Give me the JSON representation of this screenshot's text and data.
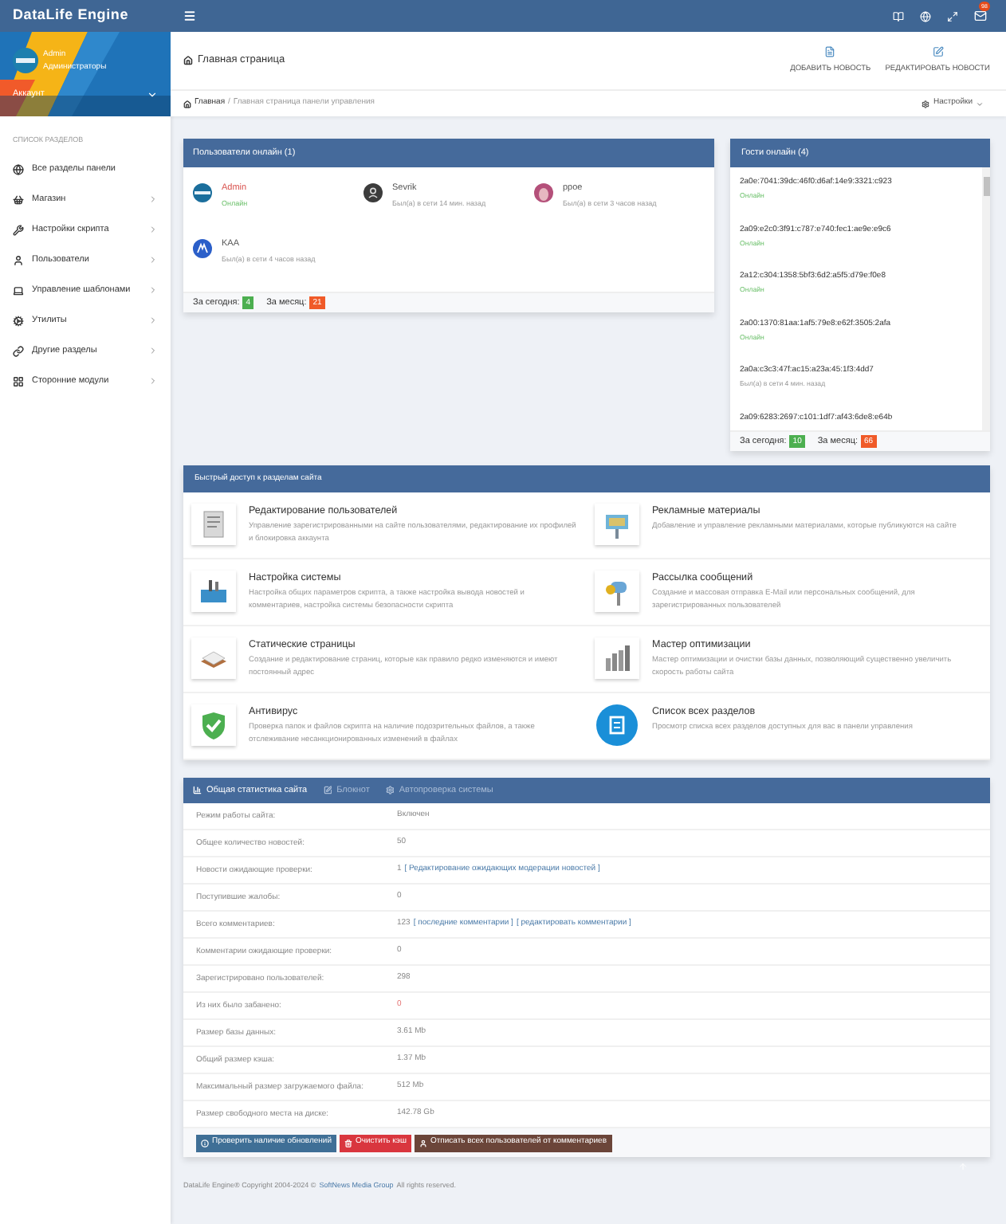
{
  "app_title": "DataLife Engine",
  "mail_badge": "98",
  "profile": {
    "name": "Admin",
    "group": "Администраторы",
    "account": "Аккаунт"
  },
  "sidebar": {
    "caption": "СПИСОК РАЗДЕЛОВ",
    "items": [
      {
        "label": "Все разделы панели",
        "has_children": false
      },
      {
        "label": "Магазин",
        "has_children": true
      },
      {
        "label": "Настройки скрипта",
        "has_children": true
      },
      {
        "label": "Пользователи",
        "has_children": true
      },
      {
        "label": "Управление шаблонами",
        "has_children": true
      },
      {
        "label": "Утилиты",
        "has_children": true
      },
      {
        "label": "Другие разделы",
        "has_children": true
      },
      {
        "label": "Сторонние модули",
        "has_children": true
      }
    ]
  },
  "page": {
    "title": "Главная страница",
    "actions": [
      "ДОБАВИТЬ НОВОСТЬ",
      "РЕДАКТИРОВАТЬ НОВОСТИ"
    ]
  },
  "breadcrumb": {
    "items": [
      "Главная",
      "Главная страница панели управления"
    ],
    "separator": "/",
    "settings": "Настройки"
  },
  "users_online": {
    "title": "Пользователи онлайн (1)",
    "users": [
      {
        "name": "Admin",
        "status": "Онлайн",
        "online": true,
        "kind": "logo",
        "color": "#d9534f"
      },
      {
        "name": "Sevrik",
        "status": "Был(а) в сети 14 мин. назад",
        "online": false,
        "kind": "default",
        "color": "#555555"
      },
      {
        "name": "ppoe",
        "status": "Был(а) в сети 3 часов назад",
        "online": false,
        "kind": "photo",
        "color": "#555555"
      },
      {
        "name": "KAA",
        "status": "Был(а) в сети 4 часов назад",
        "online": false,
        "kind": "mark",
        "color": "#555555"
      }
    ],
    "today_label": "За сегодня:",
    "today": "4",
    "month_label": "За месяц:",
    "month": "21"
  },
  "guests_online": {
    "title": "Гости онлайн (4)",
    "guests": [
      {
        "ip": "2a0e:7041:39dc:46f0:d6af:14e9:3321:c923",
        "status": "Онлайн",
        "online": true
      },
      {
        "ip": "2a09:e2c0:3f91:c787:e740:fec1:ae9e:e9c6",
        "status": "Онлайн",
        "online": true
      },
      {
        "ip": "2a12:c304:1358:5bf3:6d2:a5f5:d79e:f0e8",
        "status": "Онлайн",
        "online": true
      },
      {
        "ip": "2a00:1370:81aa:1af5:79e8:e62f:3505:2afa",
        "status": "Онлайн",
        "online": true
      },
      {
        "ip": "2a0a:c3c3:47f:ac15:a23a:45:1f3:4dd7",
        "status": "Был(а) в сети 4 мин. назад",
        "online": false
      },
      {
        "ip": "2a09:6283:2697:c101:1df7:af43:6de8:e64b"
      }
    ],
    "today_label": "За сегодня:",
    "today": "10",
    "month_label": "За месяц:",
    "month": "66"
  },
  "quick_access": {
    "title": "Быстрый доступ к разделам сайта",
    "items": [
      {
        "title": "Редактирование пользователей",
        "description": "Управление зарегистрированными на сайте пользователями, редактирование их профилей и блокировка аккаунта"
      },
      {
        "title": "Рекламные материалы",
        "description": "Добавление и управление рекламными материалами, которые публикуются на сайте"
      },
      {
        "title": "Настройка системы",
        "description": "Настройка общих параметров скрипта, а также настройка вывода новостей и комментариев, настройка системы безопасности скрипта"
      },
      {
        "title": "Рассылка сообщений",
        "description": "Создание и массовая отправка E-Mail или персональных сообщений, для зарегистрированных пользователей"
      },
      {
        "title": "Статические страницы",
        "description": "Создание и редактирование страниц, которые как правило редко изменяются и имеют постоянный адрес"
      },
      {
        "title": "Мастер оптимизации",
        "description": "Мастер оптимизации и очистки базы данных, позволяющий существенно увеличить скорость работы сайта"
      },
      {
        "title": "Антивирус",
        "description": "Проверка папок и файлов скрипта на наличие подозрительных файлов, а также отслеживание несанкционированных изменений в файлах"
      },
      {
        "title": "Список всех разделов",
        "description": "Просмотр списка всех разделов доступных для вас в панели управления"
      }
    ]
  },
  "stats": {
    "tabs": [
      {
        "label": "Общая статистика сайта",
        "selected": true
      },
      {
        "label": "Блокнот",
        "selected": false
      },
      {
        "label": "Автопроверка системы",
        "selected": false
      }
    ],
    "rows": [
      {
        "label": "Режим работы сайта:",
        "value": [
          {
            "kind": "text",
            "text": "Включен"
          }
        ]
      },
      {
        "label": "Общее количество новостей:",
        "value": [
          {
            "kind": "text",
            "text": "50"
          }
        ]
      },
      {
        "label": "Новости ожидающие проверки:",
        "value": [
          {
            "kind": "text",
            "text": "1"
          },
          {
            "kind": "link",
            "text": "[ Редактирование ожидающих модерации новостей ]"
          }
        ]
      },
      {
        "label": "Поступившие жалобы:",
        "value": [
          {
            "kind": "text",
            "text": "0"
          }
        ]
      },
      {
        "label": "Всего комментариев:",
        "value": [
          {
            "kind": "text",
            "text": "123"
          },
          {
            "kind": "link",
            "text": "[ последние комментарии ]"
          },
          {
            "kind": "link",
            "text": "[ редактировать комментарии ]"
          }
        ]
      },
      {
        "label": "Комментарии ожидающие проверки:",
        "value": [
          {
            "kind": "text",
            "text": "0"
          }
        ]
      },
      {
        "label": "Зарегистрировано пользователей:",
        "value": [
          {
            "kind": "text",
            "text": "298"
          }
        ]
      },
      {
        "label": "Из них было забанено:",
        "value": [
          {
            "kind": "danger",
            "text": "0"
          }
        ]
      },
      {
        "label": "Размер базы данных:",
        "value": [
          {
            "kind": "text",
            "text": "3.61 Mb"
          }
        ]
      },
      {
        "label": "Общий размер кэша:",
        "value": [
          {
            "kind": "text",
            "text": "1.37 Mb"
          }
        ]
      },
      {
        "label": "Максимальный размер загружаемого файла:",
        "value": [
          {
            "kind": "text",
            "text": "512 Mb"
          }
        ]
      },
      {
        "label": "Размер свободного места на диске:",
        "value": [
          {
            "kind": "text",
            "text": "142.78 Gb"
          }
        ]
      }
    ],
    "buttons": [
      {
        "label": "Проверить наличие обновлений",
        "color": "#3f6f96"
      },
      {
        "label": "Очистить кэш",
        "color": "#d9363e"
      },
      {
        "label": "Отписать всех пользователей от комментариев",
        "color": "#6b4539"
      }
    ]
  },
  "footer": [
    {
      "kind": "text",
      "text": "DataLife Engine® Copyright 2004-2024 ©"
    },
    {
      "kind": "link",
      "text": "SoftNews Media Group"
    },
    {
      "kind": "text",
      "text": "All rights reserved."
    }
  ]
}
